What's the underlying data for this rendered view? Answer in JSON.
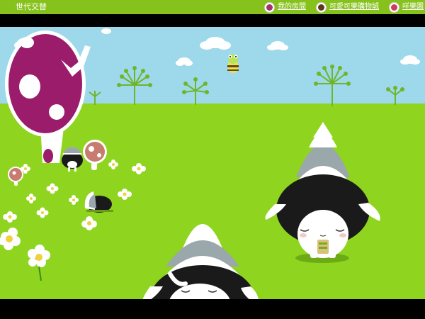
{
  "header": {
    "title": "世代交替",
    "nav": [
      {
        "label": "我的房間",
        "icon": "flower-icon",
        "color": "#a0336a"
      },
      {
        "label": "可愛可樂購物城",
        "icon": "bear-icon",
        "color": "#5a3b1b"
      },
      {
        "label": "咩樂園",
        "icon": "flower-icon",
        "color": "#d13a5a"
      }
    ]
  },
  "scene": {
    "sky_color": "#9dd9ea",
    "grass_color": "#8fd41f"
  }
}
